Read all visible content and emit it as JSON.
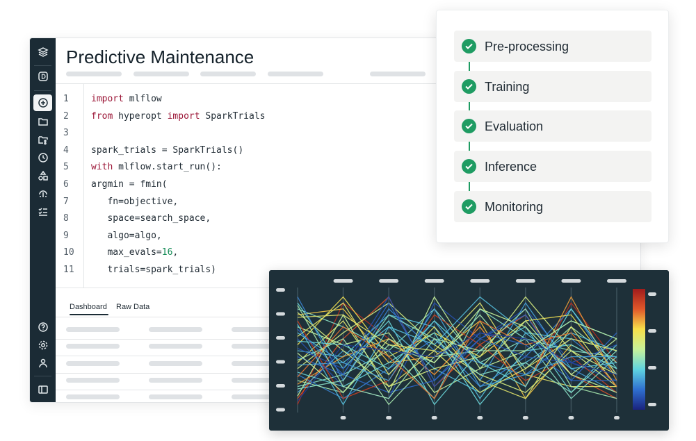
{
  "page": {
    "title": "Predictive Maintenance"
  },
  "code": {
    "lines": [
      {
        "n": "1",
        "html": "<span class='kw'>import</span> mlflow"
      },
      {
        "n": "2",
        "html": "<span class='kw'>from</span> hyperopt <span class='kw'>import</span> SparkTrials"
      },
      {
        "n": "3",
        "html": ""
      },
      {
        "n": "4",
        "html": "spark_trials = SparkTrials()"
      },
      {
        "n": "5",
        "html": "<span class='kw'>with</span> mlflow.start_run():"
      },
      {
        "n": "6",
        "html": "argmin = fmin("
      },
      {
        "n": "7",
        "html": "   fn=objective,"
      },
      {
        "n": "8",
        "html": "   space=search_space,"
      },
      {
        "n": "9",
        "html": "   algo=algo,"
      },
      {
        "n": "10",
        "html": "   max_evals=<span class='num'>16</span>,"
      },
      {
        "n": "11",
        "html": "   trials=spark_trials)"
      }
    ]
  },
  "tabs": {
    "dashboard": "Dashboard",
    "raw": "Raw Data"
  },
  "pipeline": {
    "steps": [
      "Pre-processing",
      "Training",
      "Evaluation",
      "Inference",
      "Monitoring"
    ],
    "accent": "#1f9c63"
  },
  "chart_data": {
    "type": "parallel-coordinates",
    "axes": 8,
    "range": [
      0,
      1
    ],
    "colorscale": [
      "#1a237e",
      "#2f6fd0",
      "#5fd3e0",
      "#c8f29a",
      "#f7e04a",
      "#e0572a",
      "#a11c1c"
    ],
    "lines": [
      [
        0.05,
        0.9,
        0.6,
        0.3,
        0.7,
        0.2,
        0.9,
        0.4
      ],
      [
        0.1,
        0.6,
        0.95,
        0.2,
        0.55,
        0.8,
        0.3,
        0.1
      ],
      [
        0.2,
        0.3,
        0.5,
        0.85,
        0.4,
        0.6,
        0.5,
        0.45
      ],
      [
        0.3,
        0.1,
        0.35,
        0.6,
        0.2,
        0.45,
        0.85,
        0.3
      ],
      [
        0.4,
        0.75,
        0.2,
        0.5,
        0.9,
        0.3,
        0.2,
        0.2
      ],
      [
        0.5,
        0.45,
        0.8,
        0.7,
        0.1,
        0.65,
        0.6,
        0.5
      ],
      [
        0.6,
        0.2,
        0.1,
        0.9,
        0.6,
        0.85,
        0.4,
        0.25
      ],
      [
        0.7,
        0.55,
        0.65,
        0.15,
        0.35,
        0.5,
        0.75,
        0.6
      ],
      [
        0.8,
        0.85,
        0.4,
        0.45,
        0.75,
        0.1,
        0.55,
        0.35
      ],
      [
        0.9,
        0.35,
        0.75,
        0.05,
        0.5,
        0.7,
        0.15,
        0.55
      ],
      [
        0.15,
        0.5,
        0.3,
        0.75,
        0.25,
        0.9,
        0.35,
        0.15
      ],
      [
        0.25,
        0.15,
        0.55,
        0.4,
        0.8,
        0.35,
        0.7,
        0.4
      ],
      [
        0.35,
        0.65,
        0.9,
        0.55,
        0.3,
        0.15,
        0.5,
        0.2
      ],
      [
        0.45,
        0.3,
        0.15,
        0.25,
        0.65,
        0.55,
        0.25,
        0.65
      ],
      [
        0.55,
        0.95,
        0.45,
        0.65,
        0.45,
        0.75,
        0.8,
        0.3
      ],
      [
        0.65,
        0.4,
        0.7,
        0.35,
        0.15,
        0.4,
        0.65,
        0.5
      ],
      [
        0.75,
        0.1,
        0.25,
        0.8,
        0.55,
        0.25,
        0.45,
        0.15
      ],
      [
        0.85,
        0.7,
        0.5,
        0.1,
        0.85,
        0.6,
        0.1,
        0.45
      ],
      [
        0.95,
        0.25,
        0.85,
        0.5,
        0.4,
        0.3,
        0.6,
        0.3
      ],
      [
        0.12,
        0.8,
        0.15,
        0.95,
        0.35,
        0.75,
        0.3,
        0.6
      ],
      [
        0.22,
        0.45,
        0.6,
        0.3,
        0.7,
        0.2,
        0.95,
        0.25
      ],
      [
        0.32,
        0.2,
        0.4,
        0.65,
        0.05,
        0.5,
        0.55,
        0.35
      ],
      [
        0.42,
        0.6,
        0.05,
        0.45,
        0.5,
        0.85,
        0.2,
        0.1
      ],
      [
        0.52,
        0.35,
        0.95,
        0.2,
        0.6,
        0.45,
        0.4,
        0.55
      ],
      [
        0.62,
        0.9,
        0.3,
        0.7,
        0.25,
        0.1,
        0.7,
        0.2
      ],
      [
        0.72,
        0.05,
        0.7,
        0.55,
        0.95,
        0.65,
        0.35,
        0.4
      ],
      [
        0.82,
        0.5,
        0.2,
        0.35,
        0.45,
        0.95,
        0.5,
        0.3
      ],
      [
        0.18,
        0.25,
        0.8,
        0.6,
        0.3,
        0.4,
        0.15,
        0.5
      ],
      [
        0.28,
        0.7,
        0.45,
        0.1,
        0.75,
        0.55,
        0.65,
        0.2
      ],
      [
        0.38,
        0.4,
        0.25,
        0.85,
        0.2,
        0.3,
        0.45,
        0.45
      ],
      [
        0.48,
        0.15,
        0.6,
        0.4,
        0.85,
        0.7,
        0.3,
        0.15
      ],
      [
        0.58,
        0.55,
        0.35,
        0.75,
        0.4,
        0.2,
        0.85,
        0.35
      ],
      [
        0.68,
        0.3,
        0.9,
        0.25,
        0.6,
        0.8,
        0.25,
        0.25
      ],
      [
        0.78,
        0.8,
        0.55,
        0.5,
        0.15,
        0.35,
        0.6,
        0.5
      ],
      [
        0.88,
        0.2,
        0.1,
        0.6,
        0.5,
        0.5,
        0.75,
        0.6
      ],
      [
        0.08,
        0.55,
        0.5,
        0.45,
        0.65,
        0.6,
        0.4,
        0.3
      ]
    ],
    "line_colors": [
      0.95,
      0.85,
      0.4,
      0.2,
      0.6,
      0.3,
      0.1,
      0.5,
      0.7,
      0.35,
      0.25,
      0.45,
      0.55,
      0.15,
      0.65,
      0.3,
      0.9,
      0.4,
      0.2,
      0.5,
      0.75,
      0.35,
      0.45,
      0.1,
      0.6,
      0.3,
      0.55,
      0.4,
      0.8,
      0.25,
      0.5,
      0.35,
      0.15,
      0.6,
      0.45,
      0.05
    ]
  }
}
